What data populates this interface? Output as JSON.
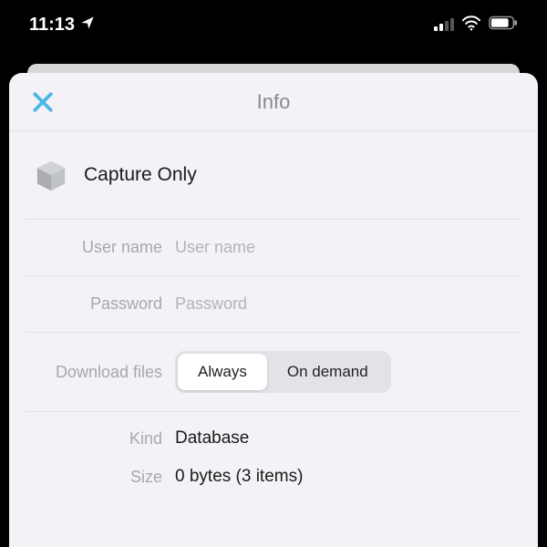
{
  "status": {
    "time": "11:13",
    "location_icon": "location-arrow-icon",
    "signal_bars": 2,
    "wifi_icon": "wifi-icon",
    "battery_icon": "battery-icon"
  },
  "sheet": {
    "close_icon": "close-icon",
    "title": "Info"
  },
  "document": {
    "icon": "cube-icon",
    "name": "Capture Only"
  },
  "fields": {
    "username": {
      "label": "User name",
      "placeholder": "User name",
      "value": ""
    },
    "password": {
      "label": "Password",
      "placeholder": "Password",
      "value": ""
    },
    "download": {
      "label": "Download files",
      "options": [
        "Always",
        "On demand"
      ],
      "selected": "Always"
    }
  },
  "info": {
    "kind": {
      "label": "Kind",
      "value": "Database"
    },
    "size": {
      "label": "Size",
      "value": "0 bytes (3 items)"
    }
  }
}
